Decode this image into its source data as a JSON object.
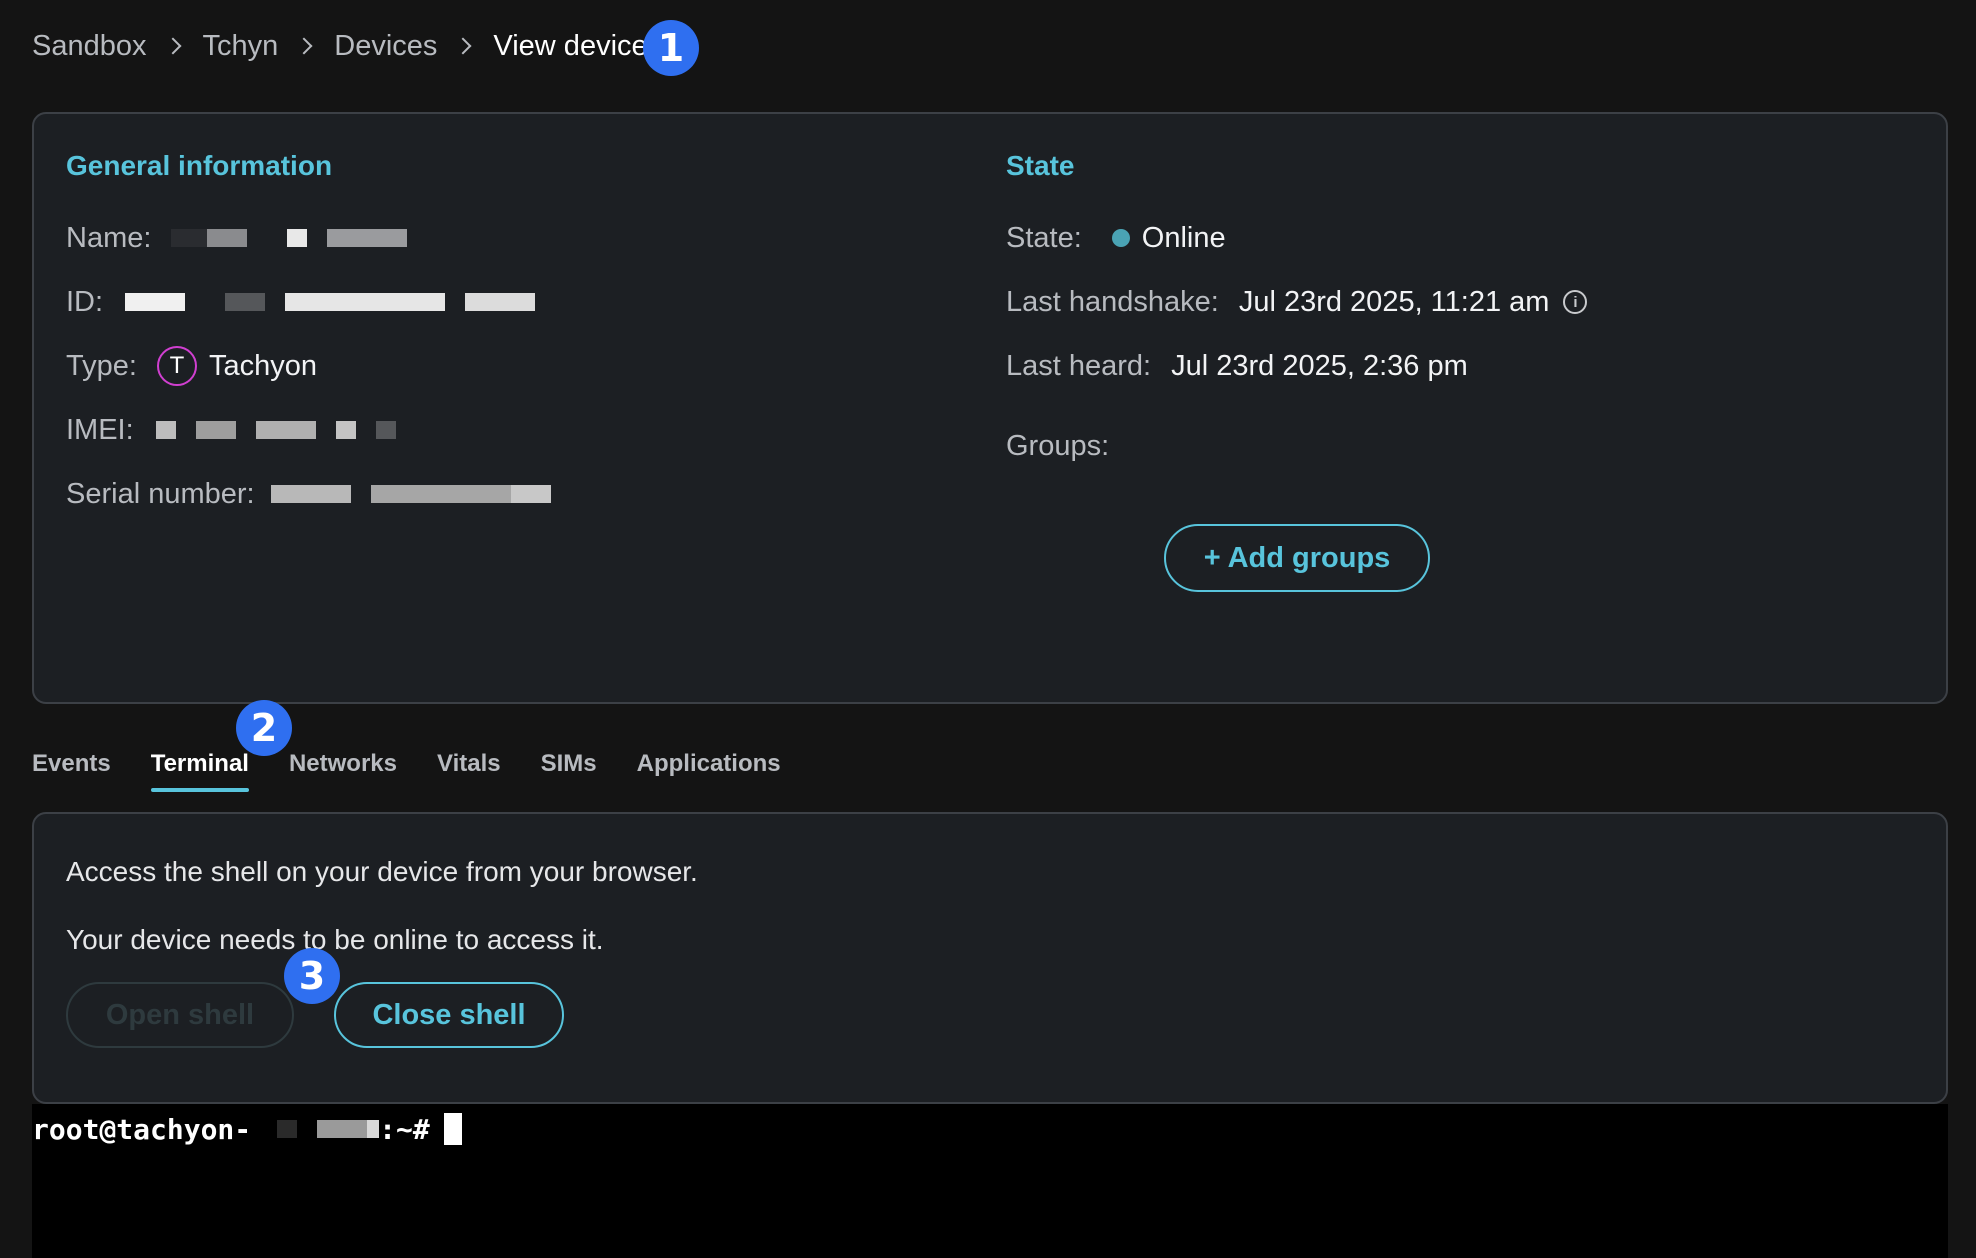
{
  "breadcrumb": {
    "items": [
      "Sandbox",
      "Tchyn",
      "Devices"
    ],
    "current": "View device"
  },
  "markers": [
    "1",
    "2",
    "3"
  ],
  "general": {
    "title": "General information",
    "name_label": "Name:",
    "id_label": "ID:",
    "type_label": "Type:",
    "type_icon_letter": "T",
    "type_value": "Tachyon",
    "imei_label": "IMEI:",
    "serial_label": "Serial number:"
  },
  "state": {
    "title": "State",
    "state_label": "State:",
    "state_value": "Online",
    "handshake_label": "Last handshake:",
    "handshake_value": "Jul 23rd 2025, 11:21 am",
    "heard_label": "Last heard:",
    "heard_value": "Jul 23rd 2025, 2:36 pm",
    "groups_label": "Groups:",
    "add_groups": "+ Add groups",
    "status_color": "#4aa3b4"
  },
  "tabs": [
    "Events",
    "Terminal",
    "Networks",
    "Vitals",
    "SIMs",
    "Applications"
  ],
  "active_tab": "Terminal",
  "terminal_panel": {
    "line1": "Access the shell on your device from your browser.",
    "line2": "Your device needs to be online to access it.",
    "open_shell": "Open shell",
    "close_shell": "Close shell"
  },
  "terminal": {
    "prompt_prefix": "root@tachyon-",
    "prompt_suffix": ":~#"
  },
  "colors": {
    "accent": "#58c4dc",
    "marker": "#2f6ff0",
    "background": "#141414",
    "card": "#1c1f23"
  }
}
